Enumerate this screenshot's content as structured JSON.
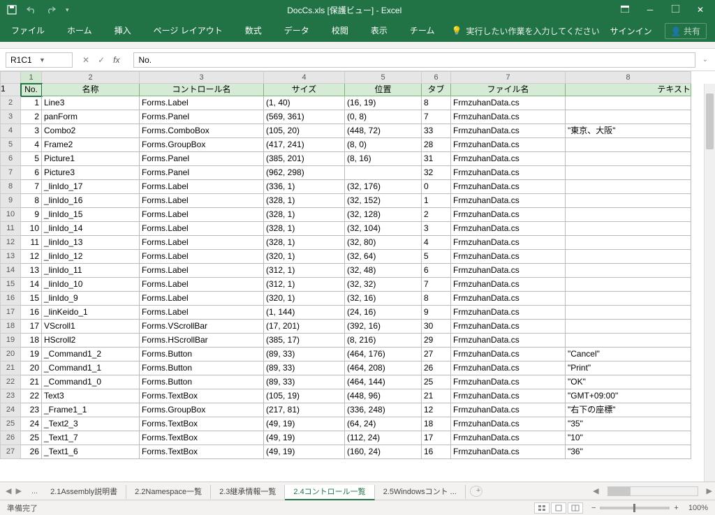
{
  "title": "DocCs.xls [保護ビュー] - Excel",
  "qat": {
    "save": "save",
    "undo": "undo",
    "redo": "redo"
  },
  "ribbon": {
    "tabs": [
      "ファイル",
      "ホーム",
      "挿入",
      "ページ レイアウト",
      "数式",
      "データ",
      "校閲",
      "表示",
      "チーム"
    ],
    "tellme": "実行したい作業を入力してください",
    "signin": "サインイン",
    "share": "共有"
  },
  "namebox": "R1C1",
  "formula": "No.",
  "col_letters": [
    "1",
    "2",
    "3",
    "4",
    "5",
    "6",
    "7",
    "8"
  ],
  "headers": [
    "No.",
    "名称",
    "コントロール名",
    "サイズ",
    "位置",
    "タブ",
    "ファイル名",
    "テキスト"
  ],
  "rows": [
    {
      "r": "2",
      "no": "1",
      "name": "Line3",
      "ctrl": "Forms.Label",
      "size": "(1, 40)",
      "pos": "(16, 19)",
      "tab": "8",
      "file": "FrmzuhanData.cs",
      "text": ""
    },
    {
      "r": "3",
      "no": "2",
      "name": "panForm",
      "ctrl": "Forms.Panel",
      "size": "(569, 361)",
      "pos": "(0, 8)",
      "tab": "7",
      "file": "FrmzuhanData.cs",
      "text": ""
    },
    {
      "r": "4",
      "no": "3",
      "name": "Combo2",
      "ctrl": "Forms.ComboBox",
      "size": "(105, 20)",
      "pos": "(448, 72)",
      "tab": "33",
      "file": "FrmzuhanData.cs",
      "text": "\"東京、大阪\""
    },
    {
      "r": "5",
      "no": "4",
      "name": "Frame2",
      "ctrl": "Forms.GroupBox",
      "size": "(417, 241)",
      "pos": "(8, 0)",
      "tab": "28",
      "file": "FrmzuhanData.cs",
      "text": ""
    },
    {
      "r": "6",
      "no": "5",
      "name": "Picture1",
      "ctrl": "Forms.Panel",
      "size": "(385, 201)",
      "pos": "(8, 16)",
      "tab": "31",
      "file": "FrmzuhanData.cs",
      "text": ""
    },
    {
      "r": "7",
      "no": "6",
      "name": "Picture3",
      "ctrl": "Forms.Panel",
      "size": "(962, 298)",
      "pos": "",
      "tab": "32",
      "file": "FrmzuhanData.cs",
      "text": ""
    },
    {
      "r": "8",
      "no": "7",
      "name": "_linIdo_17",
      "ctrl": "Forms.Label",
      "size": "(336, 1)",
      "pos": "(32, 176)",
      "tab": "0",
      "file": "FrmzuhanData.cs",
      "text": ""
    },
    {
      "r": "9",
      "no": "8",
      "name": "_linIdo_16",
      "ctrl": "Forms.Label",
      "size": "(328, 1)",
      "pos": "(32, 152)",
      "tab": "1",
      "file": "FrmzuhanData.cs",
      "text": ""
    },
    {
      "r": "10",
      "no": "9",
      "name": "_linIdo_15",
      "ctrl": "Forms.Label",
      "size": "(328, 1)",
      "pos": "(32, 128)",
      "tab": "2",
      "file": "FrmzuhanData.cs",
      "text": ""
    },
    {
      "r": "11",
      "no": "10",
      "name": "_linIdo_14",
      "ctrl": "Forms.Label",
      "size": "(328, 1)",
      "pos": "(32, 104)",
      "tab": "3",
      "file": "FrmzuhanData.cs",
      "text": ""
    },
    {
      "r": "12",
      "no": "11",
      "name": "_linIdo_13",
      "ctrl": "Forms.Label",
      "size": "(328, 1)",
      "pos": "(32, 80)",
      "tab": "4",
      "file": "FrmzuhanData.cs",
      "text": ""
    },
    {
      "r": "13",
      "no": "12",
      "name": "_linIdo_12",
      "ctrl": "Forms.Label",
      "size": "(320, 1)",
      "pos": "(32, 64)",
      "tab": "5",
      "file": "FrmzuhanData.cs",
      "text": ""
    },
    {
      "r": "14",
      "no": "13",
      "name": "_linIdo_11",
      "ctrl": "Forms.Label",
      "size": "(312, 1)",
      "pos": "(32, 48)",
      "tab": "6",
      "file": "FrmzuhanData.cs",
      "text": ""
    },
    {
      "r": "15",
      "no": "14",
      "name": "_linIdo_10",
      "ctrl": "Forms.Label",
      "size": "(312, 1)",
      "pos": "(32, 32)",
      "tab": "7",
      "file": "FrmzuhanData.cs",
      "text": ""
    },
    {
      "r": "16",
      "no": "15",
      "name": "_linIdo_9",
      "ctrl": "Forms.Label",
      "size": "(320, 1)",
      "pos": "(32, 16)",
      "tab": "8",
      "file": "FrmzuhanData.cs",
      "text": ""
    },
    {
      "r": "17",
      "no": "16",
      "name": "_linKeido_1",
      "ctrl": "Forms.Label",
      "size": "(1, 144)",
      "pos": "(24, 16)",
      "tab": "9",
      "file": "FrmzuhanData.cs",
      "text": ""
    },
    {
      "r": "18",
      "no": "17",
      "name": "VScroll1",
      "ctrl": "Forms.VScrollBar",
      "size": "(17, 201)",
      "pos": "(392, 16)",
      "tab": "30",
      "file": "FrmzuhanData.cs",
      "text": ""
    },
    {
      "r": "19",
      "no": "18",
      "name": "HScroll2",
      "ctrl": "Forms.HScrollBar",
      "size": "(385, 17)",
      "pos": "(8, 216)",
      "tab": "29",
      "file": "FrmzuhanData.cs",
      "text": ""
    },
    {
      "r": "20",
      "no": "19",
      "name": "_Command1_2",
      "ctrl": "Forms.Button",
      "size": "(89, 33)",
      "pos": "(464, 176)",
      "tab": "27",
      "file": "FrmzuhanData.cs",
      "text": "\"Cancel\""
    },
    {
      "r": "21",
      "no": "20",
      "name": "_Command1_1",
      "ctrl": "Forms.Button",
      "size": "(89, 33)",
      "pos": "(464, 208)",
      "tab": "26",
      "file": "FrmzuhanData.cs",
      "text": "\"Print\""
    },
    {
      "r": "22",
      "no": "21",
      "name": "_Command1_0",
      "ctrl": "Forms.Button",
      "size": "(89, 33)",
      "pos": "(464, 144)",
      "tab": "25",
      "file": "FrmzuhanData.cs",
      "text": "\"OK\""
    },
    {
      "r": "23",
      "no": "22",
      "name": "Text3",
      "ctrl": "Forms.TextBox",
      "size": "(105, 19)",
      "pos": "(448, 96)",
      "tab": "21",
      "file": "FrmzuhanData.cs",
      "text": "\"GMT+09:00\""
    },
    {
      "r": "24",
      "no": "23",
      "name": "_Frame1_1",
      "ctrl": "Forms.GroupBox",
      "size": "(217, 81)",
      "pos": "(336, 248)",
      "tab": "12",
      "file": "FrmzuhanData.cs",
      "text": "\"右下の座標\""
    },
    {
      "r": "25",
      "no": "24",
      "name": "_Text2_3",
      "ctrl": "Forms.TextBox",
      "size": "(49, 19)",
      "pos": "(64, 24)",
      "tab": "18",
      "file": "FrmzuhanData.cs",
      "text": "\"35\""
    },
    {
      "r": "26",
      "no": "25",
      "name": "_Text1_7",
      "ctrl": "Forms.TextBox",
      "size": "(49, 19)",
      "pos": "(112, 24)",
      "tab": "17",
      "file": "FrmzuhanData.cs",
      "text": "\"10\""
    },
    {
      "r": "27",
      "no": "26",
      "name": "_Text1_6",
      "ctrl": "Forms.TextBox",
      "size": "(49, 19)",
      "pos": "(160, 24)",
      "tab": "16",
      "file": "FrmzuhanData.cs",
      "text": "\"36\""
    }
  ],
  "sheets": {
    "ellipsis": "...",
    "tabs": [
      "2.1Assembly説明書",
      "2.2Namespace一覧",
      "2.3継承情報一覧",
      "2.4コントロール一覧",
      "2.5Windowsコント ..."
    ],
    "active": 3
  },
  "status": {
    "ready": "準備完了",
    "zoom": "100%"
  }
}
